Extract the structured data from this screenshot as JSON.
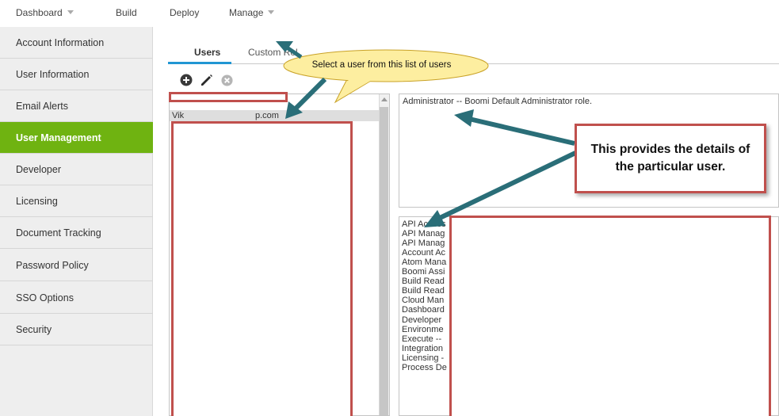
{
  "topnav": {
    "items": [
      {
        "label": "Dashboard",
        "dropdown": true
      },
      {
        "label": "Build",
        "dropdown": false
      },
      {
        "label": "Deploy",
        "dropdown": false
      },
      {
        "label": "Manage",
        "dropdown": true
      }
    ]
  },
  "sidebar": {
    "active": "User Management",
    "items": [
      {
        "label": "Account Information"
      },
      {
        "label": "User Information"
      },
      {
        "label": "Email Alerts"
      },
      {
        "label": "User Management"
      },
      {
        "label": "Developer"
      },
      {
        "label": "Licensing"
      },
      {
        "label": "Document Tracking"
      },
      {
        "label": "Password Policy"
      },
      {
        "label": "SSO Options"
      },
      {
        "label": "Security"
      }
    ]
  },
  "tabs": [
    {
      "label": "Users",
      "active": true
    },
    {
      "label": "Custom Rol",
      "active": false
    }
  ],
  "toolbar": {
    "icons": [
      "add-icon",
      "edit-icon",
      "remove-icon"
    ]
  },
  "users": {
    "rows": [
      {
        "left": "Vik",
        "right": "p.com"
      }
    ]
  },
  "role_description": "Administrator -- Boomi Default Administrator role.",
  "privileges": [
    "API Access",
    "API Manag",
    "API Manag",
    "Account Ac",
    "Atom Mana",
    "Boomi Assi",
    "Build Read",
    "Build Read",
    "Cloud Man",
    "Dashboard",
    "Developer",
    "Environme",
    "Execute --",
    "Integration",
    "Licensing -",
    "Process De"
  ],
  "callouts": {
    "bubble": "Select a user from this list of users",
    "note": "This provides the details of the particular user."
  },
  "colors": {
    "accent_green": "#6fb311",
    "tab_blue": "#2196d3",
    "annotation_red": "#c0504d",
    "arrow_teal": "#2a6e78",
    "bubble_yellow": "#fdeea0"
  }
}
